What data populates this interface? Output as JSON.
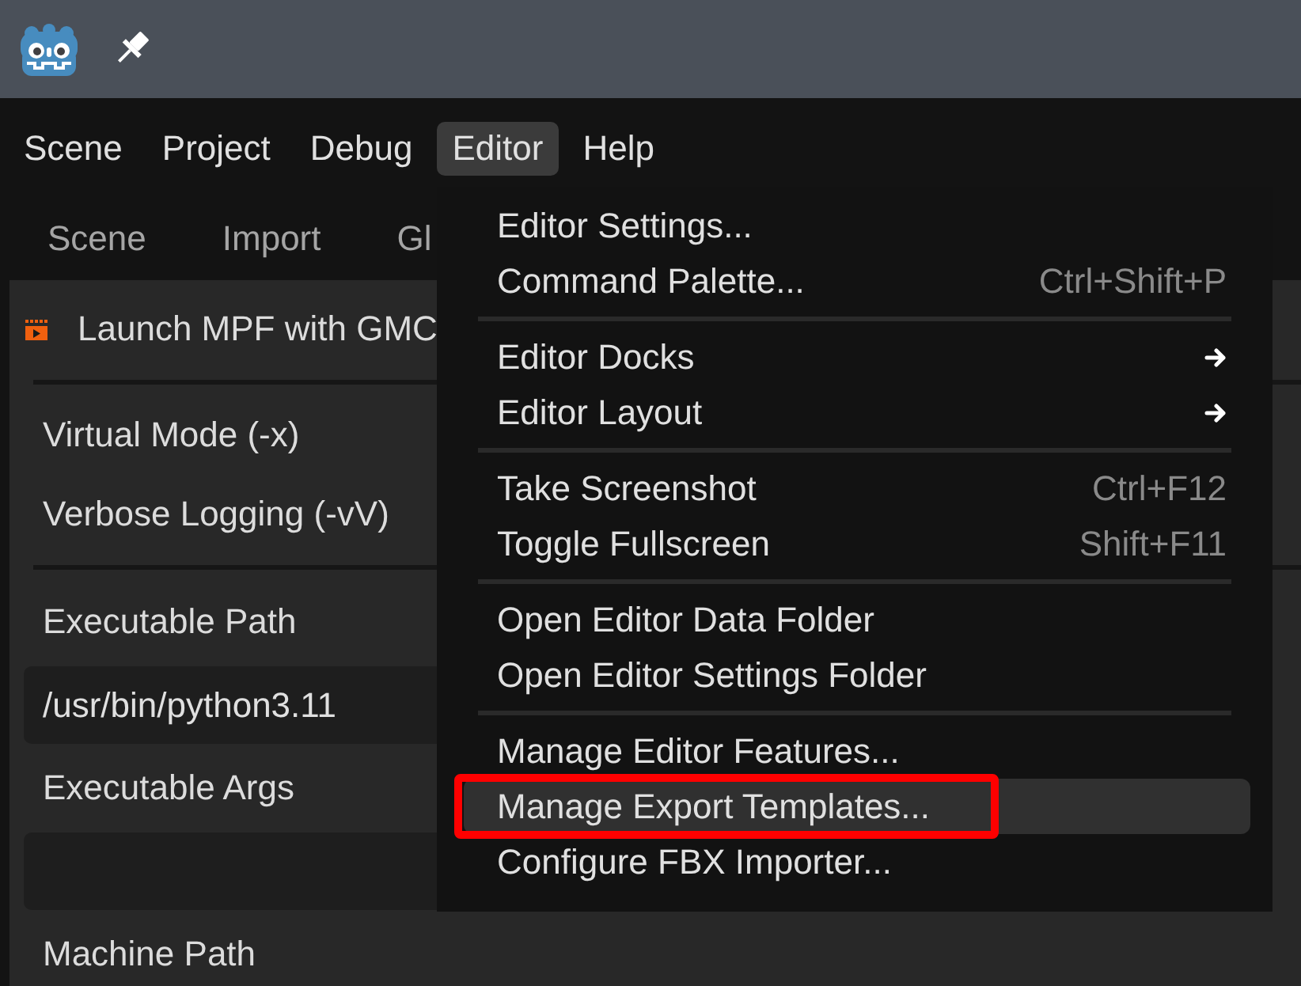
{
  "menu_bar": {
    "items": [
      {
        "label": "Scene",
        "selected": false
      },
      {
        "label": "Project",
        "selected": false
      },
      {
        "label": "Debug",
        "selected": false
      },
      {
        "label": "Editor",
        "selected": true
      },
      {
        "label": "Help",
        "selected": false
      }
    ]
  },
  "dock_tabs": [
    {
      "label": "Scene"
    },
    {
      "label": "Import"
    },
    {
      "label": "Gl"
    }
  ],
  "dock": {
    "sections": [
      {
        "items": [
          {
            "kind": "launch",
            "label": "Launch MPF with GMC"
          }
        ]
      },
      {
        "items": [
          {
            "kind": "option",
            "label": "Virtual Mode (-x)"
          },
          {
            "kind": "option",
            "label": "Verbose Logging (-vV)"
          }
        ]
      },
      {
        "items": [
          {
            "kind": "label",
            "label": "Executable Path"
          },
          {
            "kind": "field",
            "value": "/usr/bin/python3.11"
          },
          {
            "kind": "label",
            "label": "Executable Args"
          },
          {
            "kind": "field"
          },
          {
            "kind": "label",
            "label": "Machine Path"
          }
        ]
      }
    ]
  },
  "editor_menu": {
    "sections": [
      {
        "items": [
          {
            "label": "Editor Settings...",
            "submenu": false,
            "highlighted": false,
            "annotated": false
          },
          {
            "label": "Command Palette...",
            "shortcut": "Ctrl+Shift+P",
            "submenu": false,
            "highlighted": false,
            "annotated": false
          }
        ]
      },
      {
        "items": [
          {
            "label": "Editor Docks",
            "submenu": true,
            "highlighted": false,
            "annotated": false
          },
          {
            "label": "Editor Layout",
            "submenu": true,
            "highlighted": false,
            "annotated": false
          }
        ]
      },
      {
        "items": [
          {
            "label": "Take Screenshot",
            "shortcut": "Ctrl+F12",
            "submenu": false,
            "highlighted": false,
            "annotated": false
          },
          {
            "label": "Toggle Fullscreen",
            "shortcut": "Shift+F11",
            "submenu": false,
            "highlighted": false,
            "annotated": false
          }
        ]
      },
      {
        "items": [
          {
            "label": "Open Editor Data Folder",
            "submenu": false,
            "highlighted": false,
            "annotated": false
          },
          {
            "label": "Open Editor Settings Folder",
            "submenu": false,
            "highlighted": false,
            "annotated": false
          }
        ]
      },
      {
        "items": [
          {
            "label": "Manage Editor Features...",
            "submenu": false,
            "highlighted": false,
            "annotated": false
          },
          {
            "label": "Manage Export Templates...",
            "submenu": false,
            "highlighted": true,
            "annotated": true
          },
          {
            "label": "Configure FBX Importer...",
            "submenu": false,
            "highlighted": false,
            "annotated": false
          }
        ]
      }
    ]
  }
}
